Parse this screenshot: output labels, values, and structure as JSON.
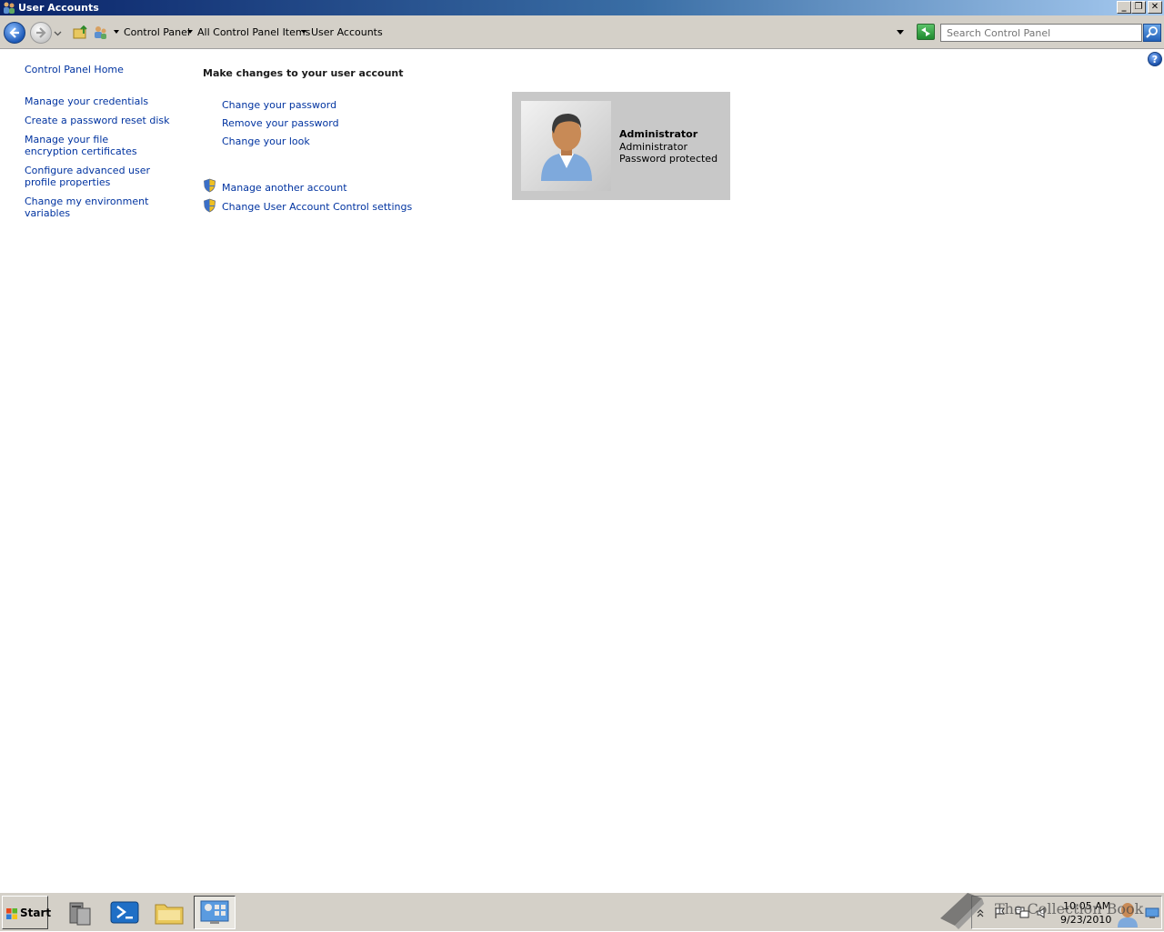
{
  "window": {
    "title": "User Accounts"
  },
  "caption_buttons": {
    "minimize": "_",
    "restore": "❐",
    "close": "✕"
  },
  "address": {
    "crumbs": [
      "Control Panel",
      "All Control Panel Items",
      "User Accounts"
    ]
  },
  "search": {
    "placeholder": "Search Control Panel"
  },
  "help": {
    "glyph": "?"
  },
  "left_pane": {
    "home": "Control Panel Home",
    "links": [
      "Manage your credentials",
      "Create a password reset disk",
      "Manage your file encryption certificates",
      "Configure advanced user profile properties",
      "Change my environment variables"
    ]
  },
  "main": {
    "heading": "Make changes to your user account",
    "tasks": [
      "Change your password",
      "Remove your password",
      "Change your look"
    ],
    "admin_tasks": [
      "Manage another account",
      "Change User Account Control settings"
    ]
  },
  "account": {
    "name": "Administrator",
    "type": "Administrator",
    "status": "Password protected"
  },
  "taskbar": {
    "start_label": "Start",
    "time": "10:05 AM",
    "date": "9/23/2010",
    "watermark": "The Collection Book"
  },
  "colors": {
    "link": "#0033a0",
    "titlebar_start": "#0a246a",
    "tile_bg": "#c8c8c8",
    "chrome": "#d4d0c8"
  }
}
